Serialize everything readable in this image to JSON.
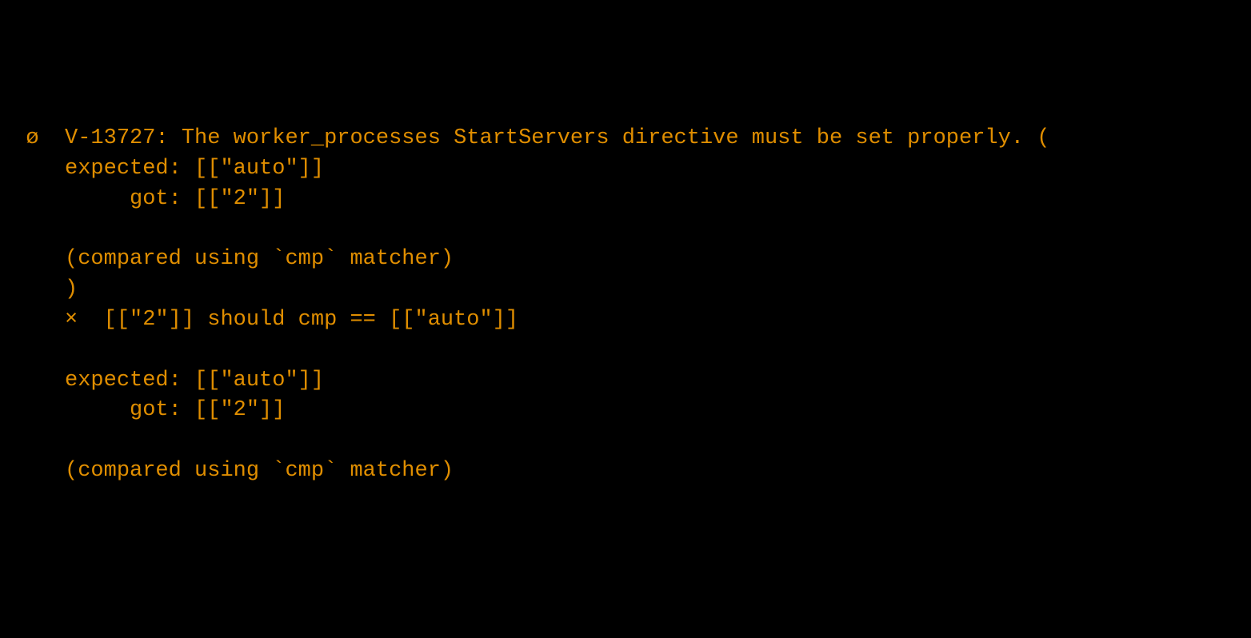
{
  "terminal": {
    "lines": [
      {
        "marker": "  ø",
        "text": "  V-13727: The worker_processes StartServers directive must be set properly. ("
      },
      {
        "marker": "   ",
        "text": "  expected: [[\"auto\"]]"
      },
      {
        "marker": "   ",
        "text": "       got: [[\"2\"]]"
      },
      {
        "marker": "   ",
        "text": ""
      },
      {
        "marker": "   ",
        "text": "  (compared using `cmp` matcher)"
      },
      {
        "marker": "   ",
        "text": "  )"
      },
      {
        "marker": "   ",
        "text": "  ×  [[\"2\"]] should cmp == [[\"auto\"]]"
      },
      {
        "marker": "   ",
        "text": ""
      },
      {
        "marker": "   ",
        "text": "  expected: [[\"auto\"]]"
      },
      {
        "marker": "   ",
        "text": "       got: [[\"2\"]]"
      },
      {
        "marker": "   ",
        "text": ""
      },
      {
        "marker": "   ",
        "text": "  (compared using `cmp` matcher)"
      }
    ]
  }
}
